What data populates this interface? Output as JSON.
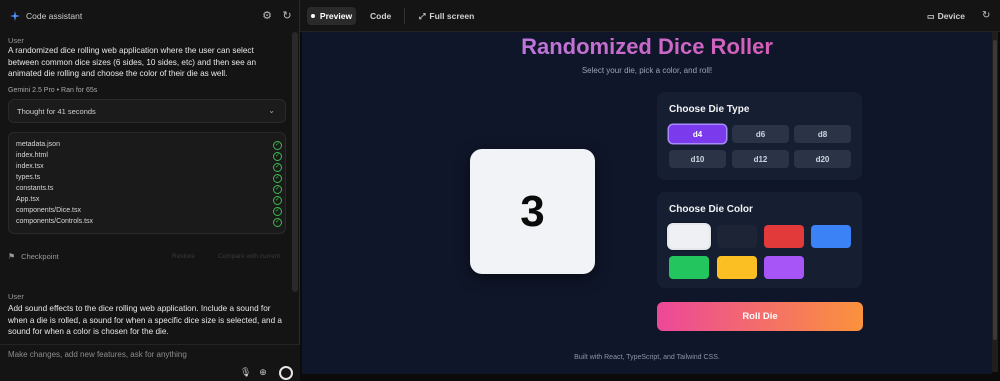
{
  "left_panel": {
    "title": "Code assistant",
    "messages": [
      {
        "role_label": "User",
        "text": "A randomized dice rolling web application where the user can select between common dice sizes (6 sides, 10 sides, etc) and then see an animated die rolling and choose the color of their die as well."
      },
      {
        "role_label": "User",
        "text": "Add sound effects to the dice rolling web application. Include a sound for when a die is rolled, a sound for when a specific dice size is selected, and a sound for when a color is chosen for the die."
      }
    ],
    "model": "Gemini 2.5 Pro",
    "run_time": "Ran for 65s",
    "thought_label": "Thought for 41 seconds",
    "files": [
      "metadata.json",
      "index.html",
      "index.tsx",
      "types.ts",
      "constants.ts",
      "App.tsx",
      "components/Dice.tsx",
      "components/Controls.tsx"
    ],
    "checkpoint_label": "Checkpoint",
    "checkpoint_faint_1": "Restore",
    "checkpoint_faint_2": "Compare with current",
    "input_placeholder": "Make changes, add new features, ask for anything"
  },
  "topbar": {
    "preview_label": "Preview",
    "code_label": "Code",
    "fullscreen_label": "Full screen",
    "device_label": "Device"
  },
  "app": {
    "title": "Randomized Dice Roller",
    "subtitle": "Select your die, pick a color, and roll!",
    "die_value": "3",
    "die_type_heading": "Choose Die Type",
    "die_types": [
      "d4",
      "d6",
      "d8",
      "d10",
      "d12",
      "d20"
    ],
    "selected_die_type": "d4",
    "die_color_heading": "Choose Die Color",
    "colors": [
      "#eef0f3",
      "#1c2435",
      "#e23a3a",
      "#3b82f6",
      "#22c55e",
      "#fbbf24",
      "#a855f7"
    ],
    "selected_color": "#eef0f3",
    "roll_label": "Roll Die",
    "footer": "Built with React, TypeScript, and Tailwind CSS."
  }
}
